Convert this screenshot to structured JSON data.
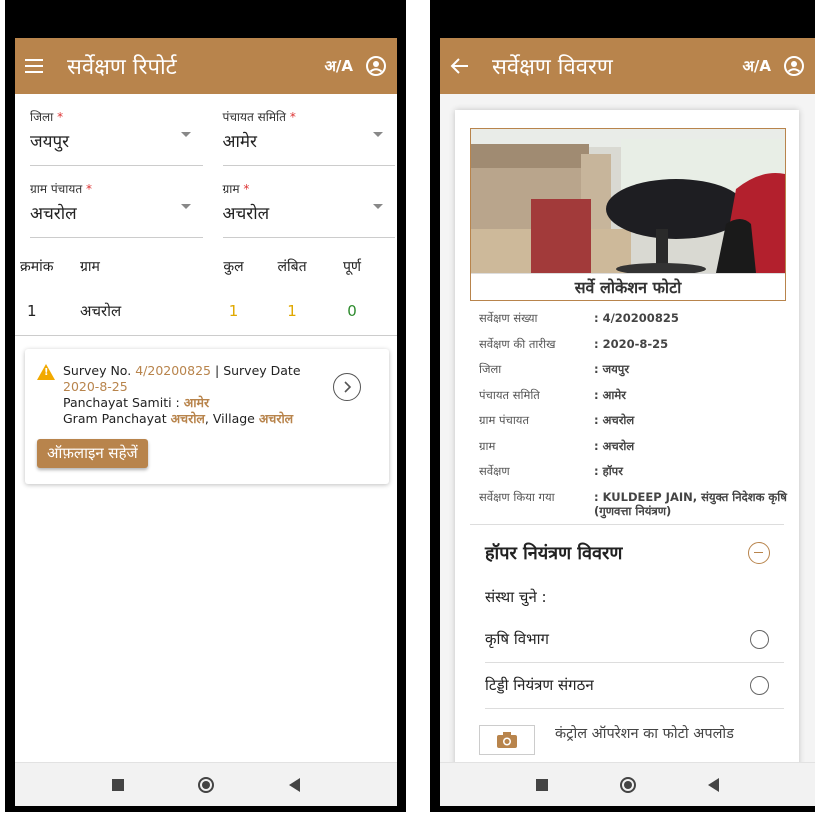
{
  "screen1": {
    "appbar": {
      "title": "सर्वेक्षण रिपोर्ट",
      "lang": "अ/A"
    },
    "fields": [
      {
        "label": "जिला",
        "required": "*",
        "value": "जयपुर"
      },
      {
        "label": "पंचायत समिति",
        "required": "*",
        "value": "आमेर"
      },
      {
        "label": "ग्राम पंचायत",
        "required": "*",
        "value": "अचरोल"
      },
      {
        "label": "ग्राम",
        "required": "*",
        "value": "अचरोल"
      }
    ],
    "table": {
      "headers": [
        "क्रमांक",
        "ग्राम",
        "कुल",
        "लंबित",
        "पूर्ण"
      ],
      "rows": [
        {
          "sno": "1",
          "village": "अचरोल",
          "total": "1",
          "pending": "1",
          "done": "0"
        }
      ]
    },
    "card": {
      "survey_no_label": "Survey No.",
      "survey_no": "4/20200825",
      "sep": "|",
      "survey_date_label": "Survey Date",
      "survey_date": "2020-8-25",
      "panchayat_samiti_label": "Panchayat Samiti :",
      "panchayat_samiti": "आमेर",
      "gram_panchayat_label": "Gram Panchayat",
      "gram_panchayat": "अचरोल",
      "village_label": ", Village",
      "village": "अचरोल",
      "offline_button": "ऑफ़लाइन सहेजें"
    }
  },
  "screen2": {
    "appbar": {
      "title": "सर्वेक्षण विवरण",
      "lang": "अ/A"
    },
    "photo_caption": "सर्वे लोकेशन फोटो",
    "info": [
      {
        "key": "सर्वेक्षण संख्या",
        "value": ": 4/20200825"
      },
      {
        "key": "सर्वेक्षण की तारीख",
        "value": ": 2020-8-25"
      },
      {
        "key": "जिला",
        "value": ": जयपुर"
      },
      {
        "key": "पंचायत समिति",
        "value": ": आमेर"
      },
      {
        "key": "ग्राम पंचायत",
        "value": ": अचरोल"
      },
      {
        "key": "ग्राम",
        "value": ": अचरोल"
      },
      {
        "key": "सर्वेक्षण",
        "value": ": हॉपर"
      },
      {
        "key": "सर्वेक्षण किया गया",
        "value": ": KULDEEP JAIN, संयुक्त निदेशक कृषि (गुणवत्ता नियंत्रण)"
      }
    ],
    "section_title": "हॉपर नियंत्रण विवरण",
    "choose_label": "संस्था चुने :",
    "options": [
      "कृषि विभाग",
      "टिड्डी नियंत्रण संगठन"
    ],
    "upload_label": "कंट्रोल ऑपरेशन का फोटो अपलोड"
  },
  "colors": {
    "accent": "#b8844c",
    "pending": "#e0a800",
    "done": "#2e8b2e",
    "warning": "#f2a900"
  },
  "icons": [
    "menu-icon",
    "translate-icon",
    "account-icon",
    "back-arrow-icon",
    "warning-icon",
    "chevron-right-circle-icon",
    "minus-circle-icon",
    "camera-icon",
    "nav-recents-icon",
    "nav-home-icon",
    "nav-back-icon"
  ]
}
